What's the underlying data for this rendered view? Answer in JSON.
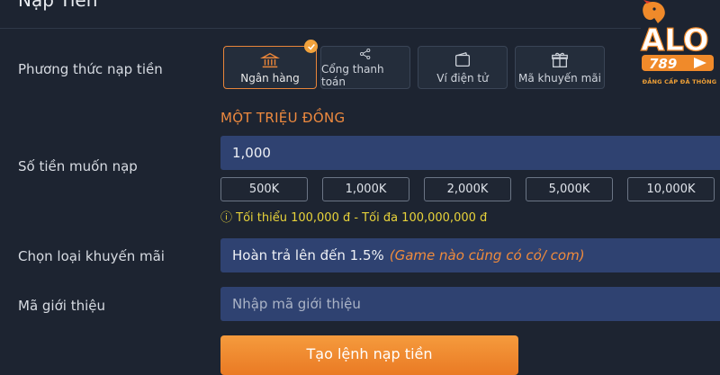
{
  "page": {
    "title": "Nạp Tiền"
  },
  "payment_method": {
    "label": "Phương thức nạp tiền",
    "options": [
      {
        "label": "Ngân hàng",
        "icon": "bank-icon",
        "selected": true
      },
      {
        "label": "Cổng thanh toán",
        "icon": "share-icon",
        "selected": false
      },
      {
        "label": "Ví điện tử",
        "icon": "wallet-icon",
        "selected": false
      },
      {
        "label": "Mã khuyến mãi",
        "icon": "gift-icon",
        "selected": false
      }
    ]
  },
  "amount": {
    "label": "Số tiền muốn nạp",
    "in_words": "MỘT TRIỆU ĐỒNG",
    "value": "1,000",
    "quick_amounts": [
      "500K",
      "1,000K",
      "2,000K",
      "5,000K",
      "10,000K"
    ],
    "hint": "ⓘ Tối thiểu 100,000 đ - Tối đa 100,000,000 đ"
  },
  "promotion": {
    "label": "Chọn loại khuyến mãi",
    "value": "Hoàn trả lên đến 1.5%",
    "note": "(Game nào cũng có cỏ/ com)"
  },
  "referral": {
    "label": "Mã giới thiệu",
    "placeholder": "Nhập mã giới thiệu"
  },
  "submit_label": "Tạo lệnh nạp tiền",
  "brand": {
    "logo_text": "ALO",
    "logo_number": "789",
    "tagline": "ĐẲNG CẤP ĐÃ THÔNG"
  },
  "colors": {
    "accent": "#ee8a3f",
    "field": "#2f4271",
    "background": "#1d2431",
    "hint": "#e8d33a"
  }
}
